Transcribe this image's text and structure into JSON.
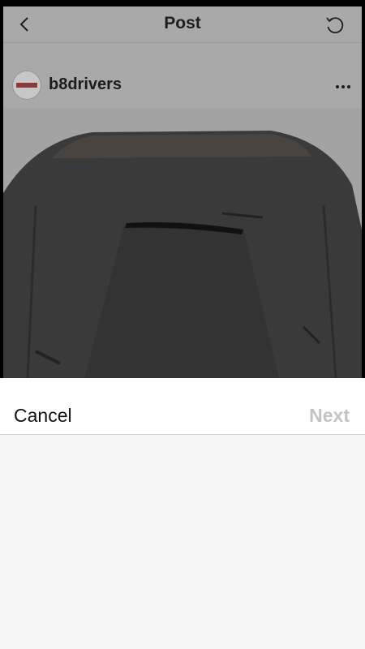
{
  "post_header": {
    "title": "Post",
    "back_icon": "chevron-left-icon",
    "refresh_icon": "refresh-icon"
  },
  "post": {
    "username": "b8drivers",
    "avatar": "brand-logo-avatar",
    "more_icon": "more-horizontal-icon",
    "image": "car-hood-photo"
  },
  "sheet": {
    "cancel_label": "Cancel",
    "next_label": "Next"
  },
  "colors": {
    "dim_overlay": "#a9a9a9",
    "sheet_bg": "#f7f7f7",
    "next_disabled": "#c3c3c3"
  }
}
